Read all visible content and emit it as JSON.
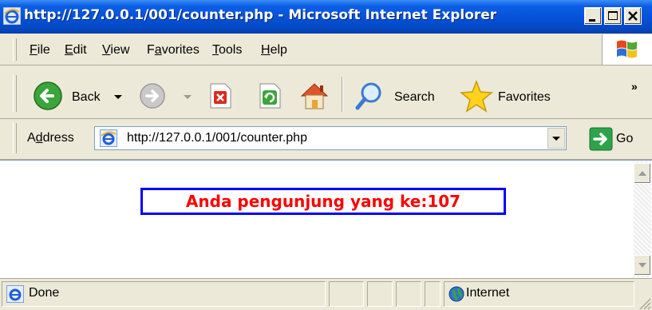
{
  "window": {
    "title": "http://127.0.0.1/001/counter.php - Microsoft Internet Explorer",
    "controls": [
      "minimize",
      "maximize",
      "close"
    ]
  },
  "menu": {
    "items": [
      {
        "label": "File",
        "accesskey": "F",
        "rest": "ile"
      },
      {
        "label": "Edit",
        "accesskey": "E",
        "rest": "dit"
      },
      {
        "label": "View",
        "accesskey": "V",
        "rest": "iew"
      },
      {
        "label": "Favorites",
        "pre": "F",
        "accesskey": "a",
        "rest": "vorites"
      },
      {
        "label": "Tools",
        "accesskey": "T",
        "rest": "ools"
      },
      {
        "label": "Help",
        "accesskey": "H",
        "rest": "elp"
      }
    ]
  },
  "toolbar": {
    "back_label": "Back",
    "search_label": "Search",
    "favorites_label": "Favorites",
    "more_label": "»"
  },
  "address": {
    "label_pre": "A",
    "label_accesskey": "d",
    "label_rest": "dress",
    "url": "http://127.0.0.1/001/counter.php",
    "go_label": "Go"
  },
  "page": {
    "counter_text": "Anda pengunjung yang ke:107"
  },
  "status": {
    "text": "Done",
    "zone": "Internet"
  },
  "colors": {
    "titlebar": "#0653d8",
    "chrome": "#ece9d8",
    "counter_text": "#ff0000",
    "counter_border": "#0000ff"
  }
}
